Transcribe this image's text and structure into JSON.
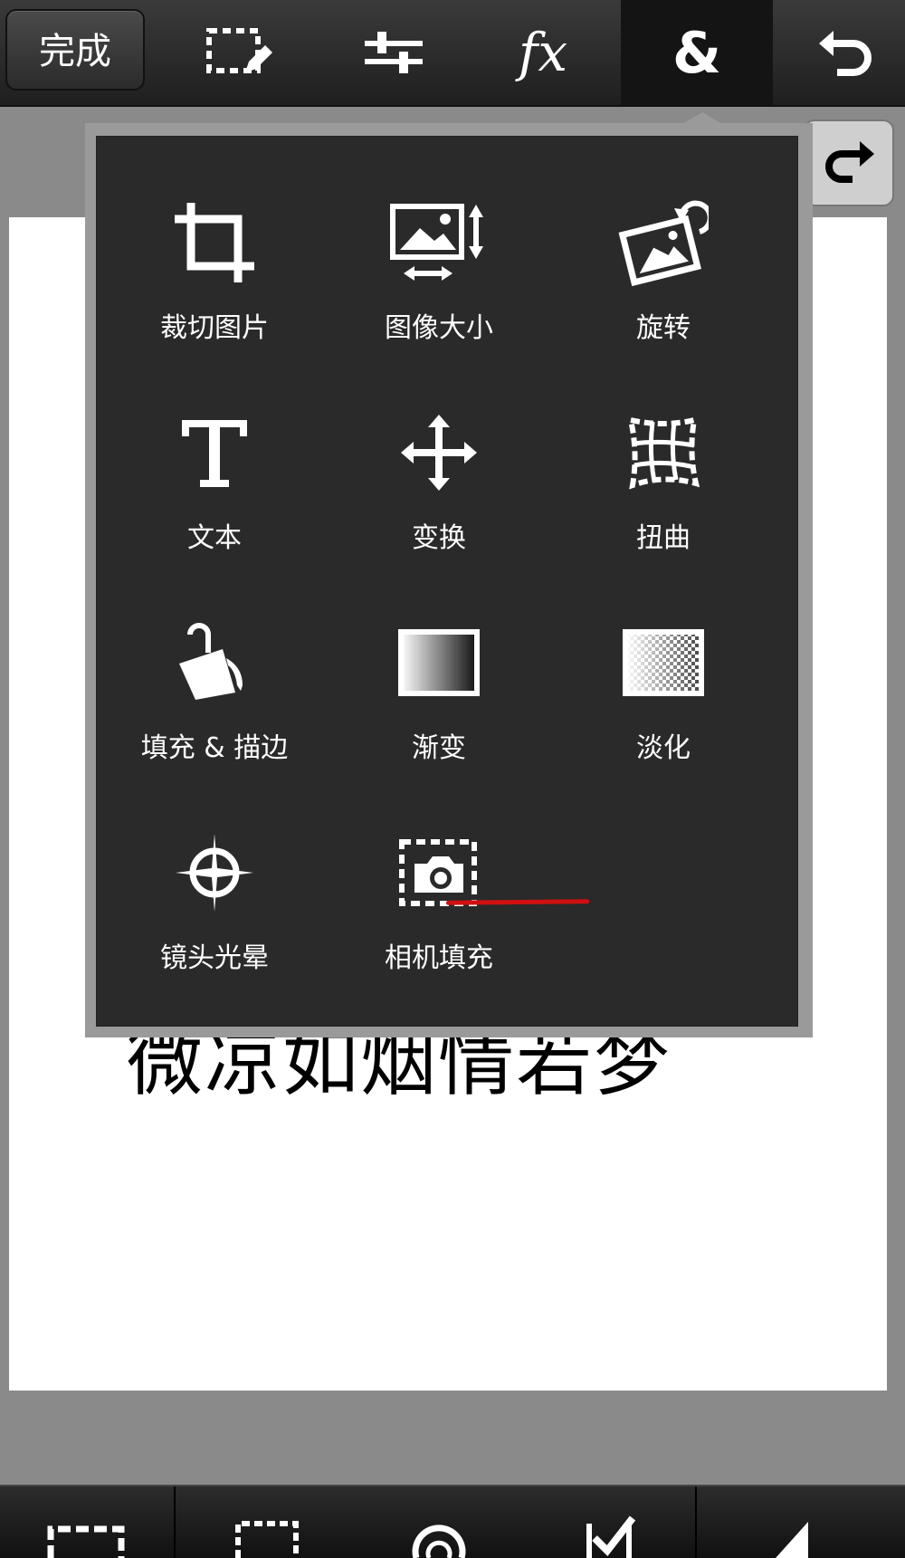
{
  "toolbar": {
    "done_label": "完成",
    "icons": [
      "selection-edit-icon",
      "adjustments-icon",
      "fx-icon",
      "ampersand-icon",
      "undo-icon"
    ],
    "fx_label": "fx",
    "amp_label": "&"
  },
  "redo": {
    "icon": "redo-icon"
  },
  "canvas": {
    "text": "微凉如烟情若梦"
  },
  "menu": {
    "items": [
      {
        "label": "裁切图片",
        "icon": "crop-icon"
      },
      {
        "label": "图像大小",
        "icon": "image-size-icon"
      },
      {
        "label": "旋转",
        "icon": "rotate-icon"
      },
      {
        "label": "文本",
        "icon": "text-icon"
      },
      {
        "label": "变换",
        "icon": "transform-icon"
      },
      {
        "label": "扭曲",
        "icon": "warp-icon"
      },
      {
        "label": "填充 & 描边",
        "icon": "fill-stroke-icon"
      },
      {
        "label": "渐变",
        "icon": "gradient-icon"
      },
      {
        "label": "淡化",
        "icon": "fade-icon"
      },
      {
        "label": "镜头光晕",
        "icon": "lens-flare-icon"
      },
      {
        "label": "相机填充",
        "icon": "camera-fill-icon"
      }
    ],
    "highlight_color": "#d01010"
  },
  "bottombar": {
    "icons": [
      "marquee-icon",
      "select-icon",
      "lasso-icon",
      "check-icon",
      "arrow-icon"
    ]
  },
  "colors": {
    "toolbar": "#2b2b2b",
    "popup": "#2a2a2a",
    "canvas_bg": "#8a8a8a"
  }
}
